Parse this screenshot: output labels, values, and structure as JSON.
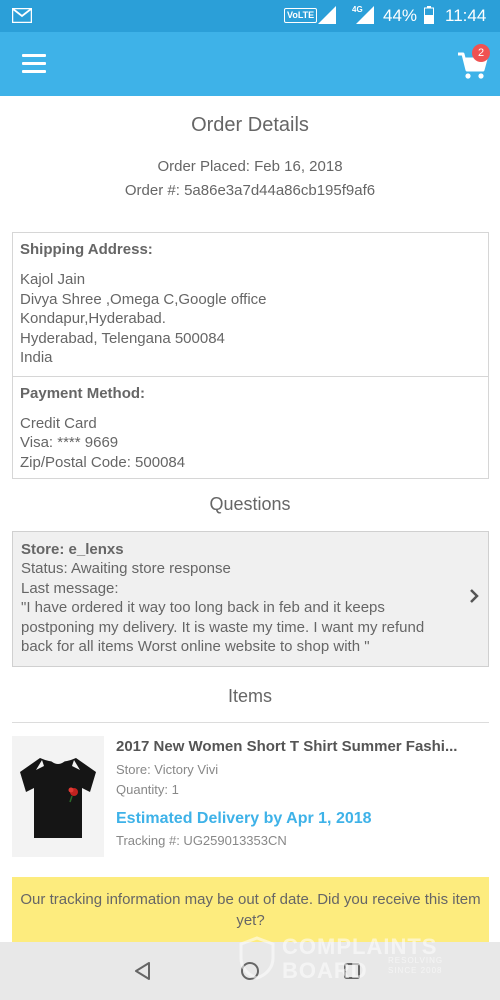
{
  "status_bar": {
    "network_label": "VoLTE",
    "network_type": "4G",
    "battery": "44%",
    "time": "11:44"
  },
  "app_bar": {
    "cart_count": "2"
  },
  "page": {
    "title": "Order Details",
    "order_placed": "Order Placed: Feb 16, 2018",
    "order_number": "Order #: 5a86e3a7d44a86cb195f9af6"
  },
  "shipping": {
    "heading": "Shipping Address:",
    "lines": [
      "Kajol Jain",
      "Divya Shree ,Omega C,Google office",
      "Kondapur,Hyderabad.",
      "Hyderabad, Telengana 500084",
      "India"
    ]
  },
  "payment": {
    "heading": "Payment Method:",
    "lines": [
      "Credit Card",
      "Visa: **** 9669",
      "Zip/Postal Code: 500084"
    ]
  },
  "questions": {
    "title": "Questions",
    "store": "Store: e_lenxs",
    "status": "Status: Awaiting store response",
    "last_message_label": "Last message:",
    "last_message": "\"I have ordered it way too long back in feb and it keeps postponing my delivery. It is waste my time. I want my refund back for all items Worst online website to shop with \""
  },
  "items": {
    "title": "Items",
    "list": [
      {
        "title": "2017 New Women Short T Shirt Summer Fashi...",
        "store": "Store: Victory Vivi",
        "quantity": "Quantity: 1",
        "delivery": "Estimated Delivery by Apr 1, 2018",
        "tracking": "Tracking #: UG259013353CN",
        "image_icon": "black-tshirt-with-rose-image"
      }
    ]
  },
  "tracking_banner": {
    "text": "Our tracking information may be out of date. Did you receive this item yet?"
  },
  "watermark": {
    "line1": "COMPLAINTS",
    "line2": "BOARD",
    "tagline1": "RESOLVING",
    "tagline2": "SINCE 2008"
  },
  "colors": {
    "status_bar": "#2b9fd8",
    "app_bar": "#3eb2e8",
    "badge": "#f05252",
    "delivery_text": "#3eb2e8",
    "banner": "#fdec7e"
  }
}
